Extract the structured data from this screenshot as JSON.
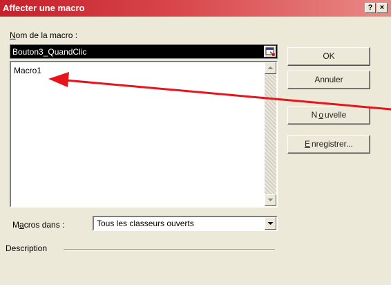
{
  "window": {
    "title": "Affecter une macro",
    "help_label": "?",
    "close_label": "×"
  },
  "macro_name": {
    "label_accel": "N",
    "label_rest": "om de la macro :",
    "value": "Bouton3_QuandClic"
  },
  "macro_list": {
    "items": [
      "Macro1"
    ]
  },
  "buttons": {
    "ok": "OK",
    "cancel": "Annuler",
    "new_pre": "N",
    "new_accel": "o",
    "new_post": "uvelle",
    "record_accel": "E",
    "record_rest": "nregistrer..."
  },
  "macros_in": {
    "label_pre": "M",
    "label_accel": "a",
    "label_post": "cros dans :",
    "value": "Tous les classeurs ouverts"
  },
  "description": {
    "label": "Description"
  },
  "annotation": {
    "color": "#e8141b"
  },
  "colors": {
    "title_bar": "#c4212b",
    "dialog_bg": "#ece9d8"
  }
}
